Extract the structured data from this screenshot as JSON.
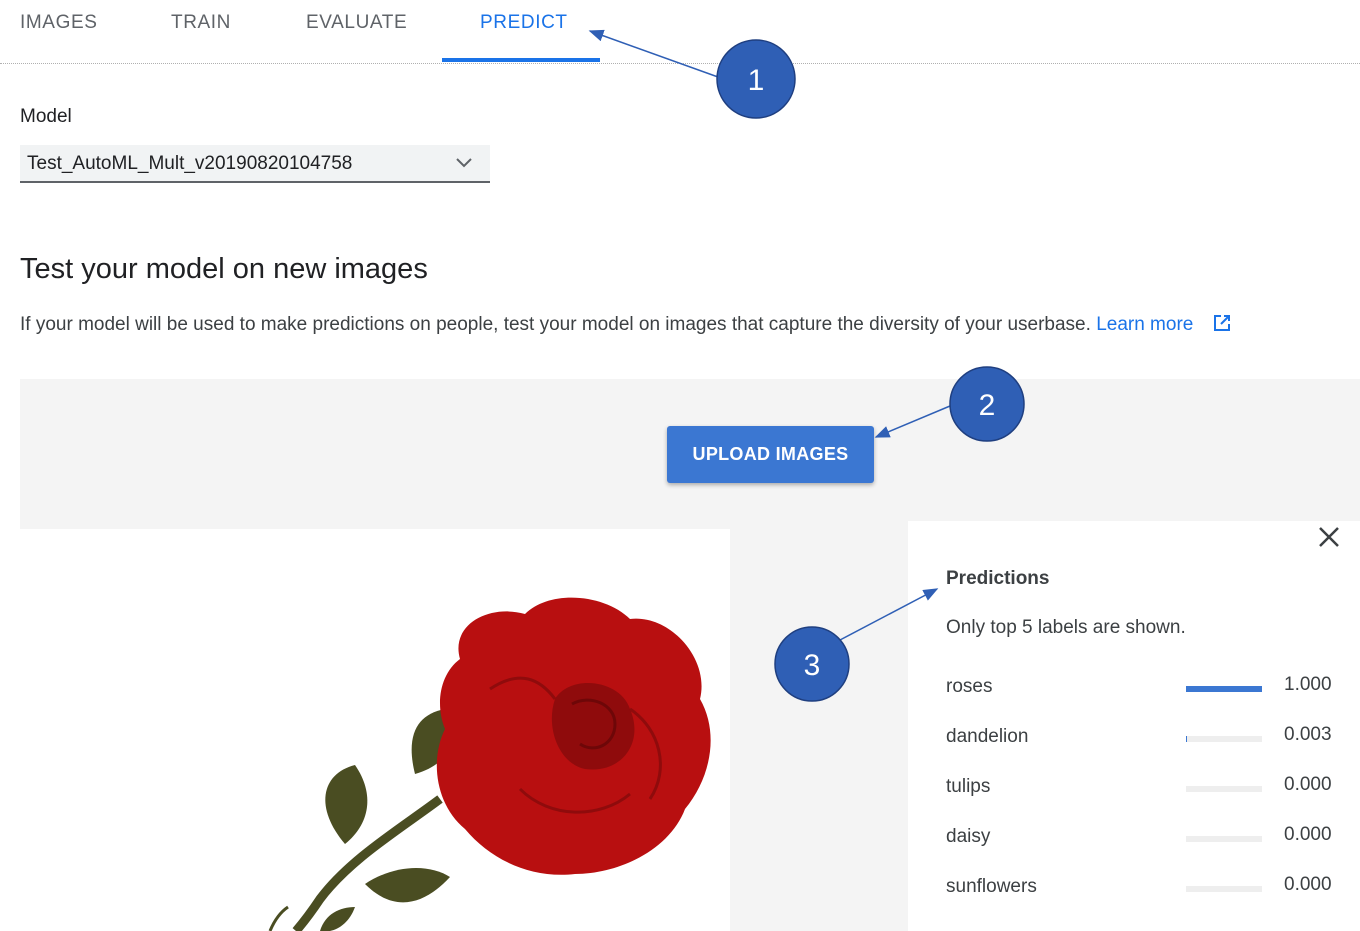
{
  "tabs": [
    {
      "label": "IMAGES",
      "active": false
    },
    {
      "label": "TRAIN",
      "active": false
    },
    {
      "label": "EVALUATE",
      "active": false
    },
    {
      "label": "PREDICT",
      "active": true
    }
  ],
  "model": {
    "label": "Model",
    "selected": "Test_AutoML_Mult_v20190820104758"
  },
  "test_section": {
    "title": "Test your model on new images",
    "description": "If your model will be used to make predictions on people, test your model on images that capture the diversity of your userbase.",
    "learn_more": "Learn more"
  },
  "upload": {
    "button_label": "UPLOAD IMAGES"
  },
  "predictions": {
    "title": "Predictions",
    "note": "Only top 5 labels are shown.",
    "items": [
      {
        "label": "roses",
        "score": "1.000",
        "value": 1.0
      },
      {
        "label": "dandelion",
        "score": "0.003",
        "value": 0.003
      },
      {
        "label": "tulips",
        "score": "0.000",
        "value": 0.0
      },
      {
        "label": "daisy",
        "score": "0.000",
        "value": 0.0
      },
      {
        "label": "sunflowers",
        "score": "0.000",
        "value": 0.0
      }
    ]
  },
  "callouts": [
    "1",
    "2",
    "3"
  ],
  "colors": {
    "accent": "#1a73e8",
    "button": "#3b77d2",
    "callout": "#2f5fb5",
    "rose": "#b80f10",
    "leaf": "#4a4d22"
  }
}
